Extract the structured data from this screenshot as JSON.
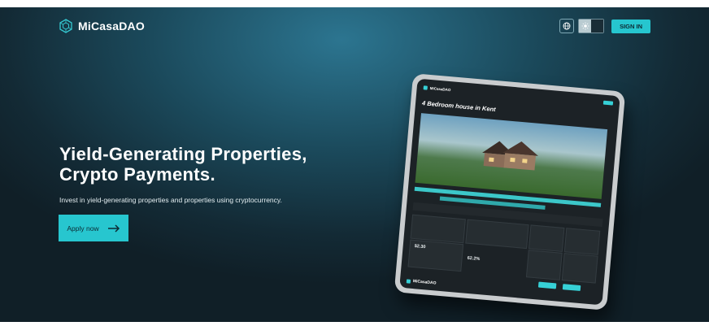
{
  "header": {
    "brand": "MiCasaDAO",
    "sign_in_label": "SIGN IN",
    "icons": [
      "logo-mark-icon",
      "globe-icon",
      "sun-icon"
    ]
  },
  "hero": {
    "title_line1": "Yield-Generating Properties,",
    "title_line2": "Crypto Payments.",
    "subtitle": "Invest in yield-generating properties and properties using cryptocurrency.",
    "cta_label": "Apply now"
  },
  "tablet": {
    "brand": "MiCasaDAO",
    "listing_title": "4 Bedroom house in Kent",
    "price": "$2.30",
    "percent": "62.2%",
    "footer_brand": "MiCasaDAO"
  },
  "colors": {
    "accent": "#26c6cf",
    "background_dark": "#132a35",
    "text_light": "#ffffff"
  }
}
